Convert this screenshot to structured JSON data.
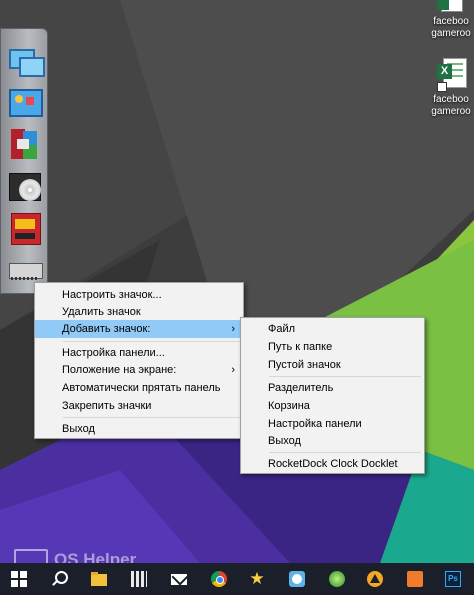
{
  "desktop": {
    "icons": [
      {
        "label_line1": "faceboo",
        "label_line2": "gameroo",
        "icon": "excel-file-icon"
      },
      {
        "label_line1": "faceboo",
        "label_line2": "gameroo",
        "icon": "excel-file-icon"
      }
    ]
  },
  "dock": {
    "items": [
      {
        "name": "network-computers-icon"
      },
      {
        "name": "control-panel-icon"
      },
      {
        "name": "winrar-icon"
      },
      {
        "name": "cd-drive-icon"
      },
      {
        "name": "archive-box-icon"
      },
      {
        "name": "memory-chip-icon"
      }
    ]
  },
  "context_menu": {
    "items": [
      {
        "label": "Настроить значок..."
      },
      {
        "label": "Удалить значок"
      },
      {
        "label": "Добавить значок:",
        "has_submenu": true,
        "highlighted": true
      },
      {
        "label": "Настройка панели..."
      },
      {
        "label": "Положение на экране:",
        "has_submenu": true
      },
      {
        "label": "Автоматически прятать панель"
      },
      {
        "label": "Закрепить значки"
      },
      {
        "label": "Выход"
      }
    ],
    "submenu_arrow": "›"
  },
  "submenu": {
    "items": [
      {
        "label": "Файл"
      },
      {
        "label": "Путь к папке"
      },
      {
        "label": "Пустой значок"
      },
      {
        "label": "Разделитель"
      },
      {
        "label": "Корзина"
      },
      {
        "label": "Настройка панели"
      },
      {
        "label": "Выход"
      },
      {
        "label": "RocketDock Clock Docklet"
      }
    ]
  },
  "watermark": {
    "text": "OS Helper"
  },
  "taskbar": {
    "items": [
      {
        "name": "start-windows-icon"
      },
      {
        "name": "search-icon"
      },
      {
        "name": "file-explorer-icon"
      },
      {
        "name": "calculator-icon"
      },
      {
        "name": "mail-icon"
      },
      {
        "name": "chrome-icon"
      },
      {
        "name": "star-app-icon"
      },
      {
        "name": "image-viewer-icon"
      },
      {
        "name": "green-app-icon"
      },
      {
        "name": "aimp-icon"
      },
      {
        "name": "orange-app-icon"
      },
      {
        "name": "photoshop-icon"
      }
    ]
  },
  "colors": {
    "menu_highlight": "#91c9f7",
    "taskbar": "#1b1f2a",
    "wallpaper_dark": "#3b3b3b",
    "wallpaper_purple": "#4b2fa0",
    "wallpaper_green": "#7ac143",
    "wallpaper_teal": "#1aa98e"
  }
}
